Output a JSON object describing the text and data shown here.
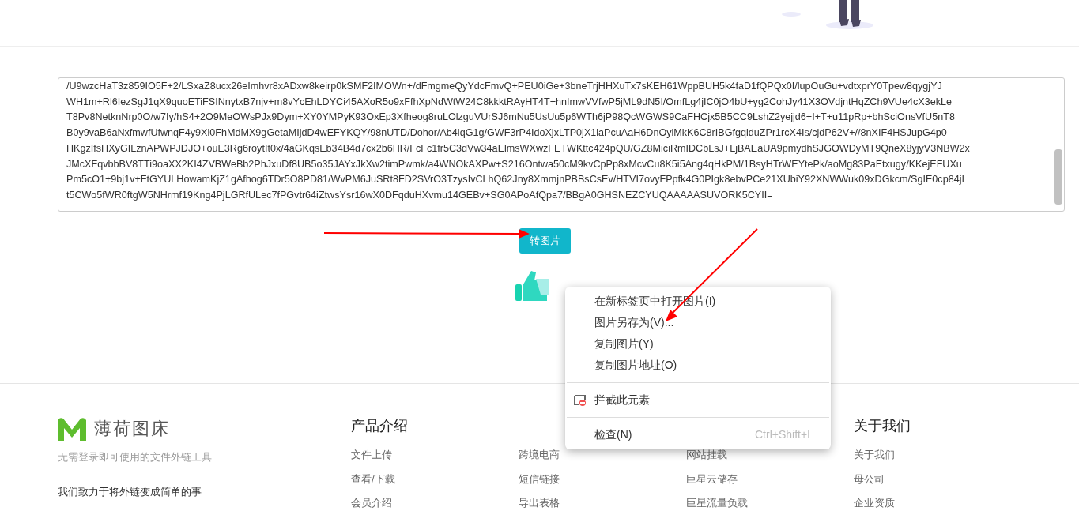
{
  "textarea": {
    "lines": [
      "/U9wzcHaT3z859IO5F+2/LSxaZ8ucx26eImhvr8xADxw8keirp0kSMF2IMOWn+/dFmgmeQyYdcFmvQ+PEU0iGe+3bneTrjHHXuTx7sKEH61WppBUH5k4faD1fQPQx0I/lupOuGu+vdtxprY0Tpew8qygjYJ",
      "WH1m+Rl6IezSgJ1qX9quoETiFSINnytxB7njv+m8vYcEhLDYCi45AXoR5o9xFfhXpNdWtW24C8kkktRAyHT4T+hnImwVVfwP5jML9dN5I/OmfLg4jIC0jO4bU+yg2CohJy41X3OVdjntHqZCh9VUe4cX3ekLe",
      "T8Pv8NetknNrp0O/w7Iy/hS4+2O9MeOWsPJx9Dym+XY0YMPyK93OxEp3Xfheog8ruLOlzguVUrSJ6mNu5UsUu5p6WTh6jP98QcWGWS9CaFHCjx5B5CC9LshZ2yejjd6+I+T+u11pRp+bhSciOnsVfU5nT8",
      "B0y9vaB6aNxfmwfUfwnqF4y9Xi0FhMdMX9gGetaMIjdD4wEFYKQY/98nUTD/Dohor/Ab4iqG1g/GWF3rP4IdoXjxLTP0jX1iaPcuAaH6DnOyiMkK6C8rIBGfgqiduZPr1rcX4Is/cjdP62V+//8nXIF4HSJupG4p0",
      "HKgzIfsHXyGILznAPWPJDJO+ouE3Rg6roytIt0x/4aGKqsEb34B4d7cx2b6HR/FcFc1fr5C3dVw34aElmsWXwzFETWKttc424pQU/GZ8MiciRmIDCbLsJ+LjBAEaUA9pmydhSJGOWDyMT9QneX8yjyV3NBW2x",
      "JMcXFqvbbBV8TTi9oaXX2KI4ZVBWeBb2PhJxuDf8UB5o35JAYxJkXw2timPwmk/a4WNOkAXPw+S216Ontwa50cM9kvCpPp8xMcvCu8K5i5Ang4qHkPM/1BsyHTrWEYtePk/aoMg83PaEtxugy/KKejEFUXu",
      "Pm5cO1+9bj1v+FtGYULHowamKjZ1gAfhog6TDr5O8PD81/WvPM6JuSRt8FD2SVrO3TzysIvCLhQ62Jny8XmmjnPBBsCsEv/HTVI7ovyFPpfk4G0PIgk8ebvPCe21XUbiY92XNWWuk09xDGkcm/SgIE0cp84jI",
      "t5CWo5fWR0ftgW5NHrmf19Kng4PjLGRfULec7fPGvtr64iZtwsYsr16wX0DFqduHXvmu14GEBv+SG0APoAfQpa7/BBgA0GHSNEZCYUQAAAAASUVORK5CYII="
    ]
  },
  "convert_button": "转图片",
  "context_menu": {
    "items": [
      {
        "kind": "item",
        "label": "在新标签页中打开图片(I)"
      },
      {
        "kind": "item",
        "label": "图片另存为(V)..."
      },
      {
        "kind": "item",
        "label": "复制图片(Y)"
      },
      {
        "kind": "item",
        "label": "复制图片地址(O)"
      },
      {
        "kind": "separator"
      },
      {
        "kind": "block",
        "label": "拦截此元素"
      },
      {
        "kind": "separator"
      },
      {
        "kind": "item",
        "label": "检查(N)",
        "shortcut": "Ctrl+Shift+I"
      }
    ]
  },
  "footer": {
    "brand": "薄荷图床",
    "tagline": "无需登录即可使用的文件外链工具",
    "slogan": "我们致力于将外链变成简单的事",
    "columns": [
      {
        "heading": "产品介绍",
        "links": [
          "文件上传",
          "查看/下载",
          "会员介绍"
        ]
      },
      {
        "links": [
          "跨境电商",
          "短信链接",
          "导出表格"
        ]
      },
      {
        "links": [
          "网站挂载",
          "巨星云储存",
          "巨星流量负载"
        ]
      },
      {
        "heading": "关于我们",
        "links": [
          "关于我们",
          "母公司",
          "企业资质"
        ]
      }
    ]
  }
}
